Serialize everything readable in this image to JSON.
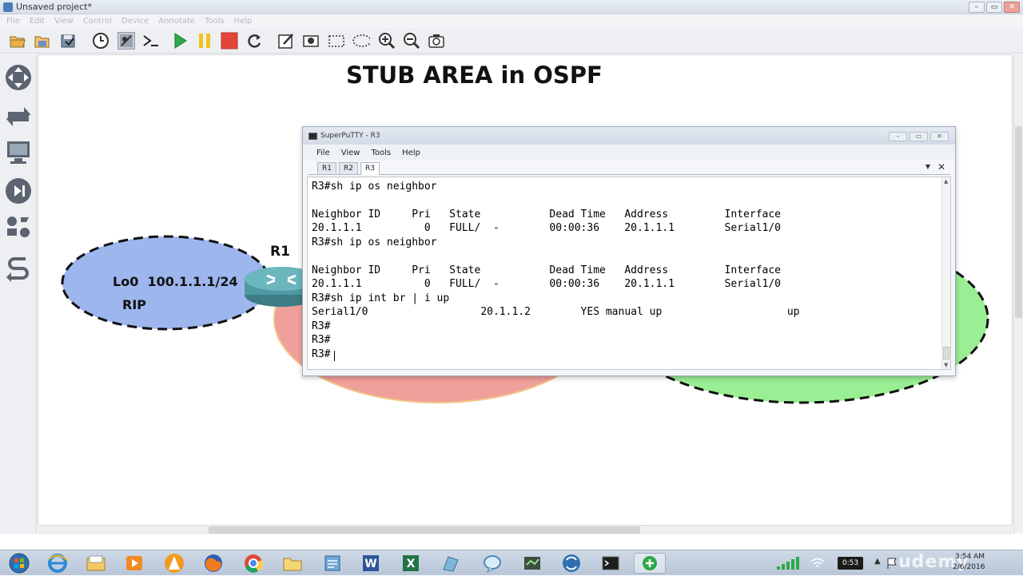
{
  "window": {
    "title": "Unsaved project*",
    "controls": {
      "minimize": "–",
      "maximize": "▭",
      "close": "✕"
    }
  },
  "menubar": [
    "File",
    "Edit",
    "View",
    "Control",
    "Device",
    "Annotate",
    "Tools",
    "Help"
  ],
  "toolbar": {
    "icons": [
      "open-folder-icon",
      "open-project-icon",
      "save-icon",
      "snapshot-clock-icon",
      "show-interfaces-icon",
      "console-all-icon",
      "start-all-icon",
      "suspend-all-icon",
      "stop-all-icon",
      "reload-all-icon",
      "annotate-note-icon",
      "insert-picture-icon",
      "draw-rectangle-icon",
      "draw-ellipse-icon",
      "zoom-in-icon",
      "zoom-out-icon",
      "screenshot-icon"
    ],
    "colors": {
      "start": "#2ea84a",
      "suspend": "#f2c21b",
      "stop": "#e0473a"
    }
  },
  "leftpanel": {
    "icons": [
      "routers-icon",
      "switches-icon",
      "end-devices-icon",
      "security-devices-icon",
      "all-devices-icon",
      "add-link-icon"
    ]
  },
  "canvas": {
    "heading": "STUB AREA in OSPF",
    "diagram": {
      "router_label": "R1",
      "left_area": {
        "line1": "Lo0  100.1.1.1/24",
        "line2": "RIP",
        "color": "#9db6ee"
      },
      "middle_area_color": "#f0a09a",
      "right_area_color": "#9aee93"
    }
  },
  "putty": {
    "title": "SuperPuTTY - R3",
    "menu": [
      "File",
      "View",
      "Tools",
      "Help"
    ],
    "tabs": [
      "R1",
      "R2",
      "R3"
    ],
    "active_tab": "R3",
    "lines": [
      "R3#sh ip os neighbor",
      "",
      "Neighbor ID     Pri   State           Dead Time   Address         Interface",
      "20.1.1.1          0   FULL/  -        00:00:36    20.1.1.1        Serial1/0",
      "R3#sh ip os neighbor",
      "",
      "Neighbor ID     Pri   State           Dead Time   Address         Interface",
      "20.1.1.1          0   FULL/  -        00:00:36    20.1.1.1        Serial1/0",
      "R3#sh ip int br | i up",
      "Serial1/0                  20.1.1.2        YES manual up                    up",
      "R3#",
      "R3#",
      "R3#"
    ]
  },
  "taskbar": {
    "apps": [
      "start-orb-icon",
      "internet-explorer-icon",
      "file-explorer-icon",
      "media-player-icon",
      "vlc-player-icon",
      "firefox-icon",
      "chrome-icon",
      "folder-icon",
      "notepad-pad-icon",
      "word-icon",
      "excel-icon",
      "paint-icon",
      "messenger-icon",
      "gns3-icon",
      "webex-icon",
      "terminal-icon",
      "gns3-active-icon"
    ],
    "active_index": 16,
    "clock_badge": "0:53",
    "time": "3:54 AM",
    "date": "2/6/2016",
    "watermark": "udemy"
  }
}
